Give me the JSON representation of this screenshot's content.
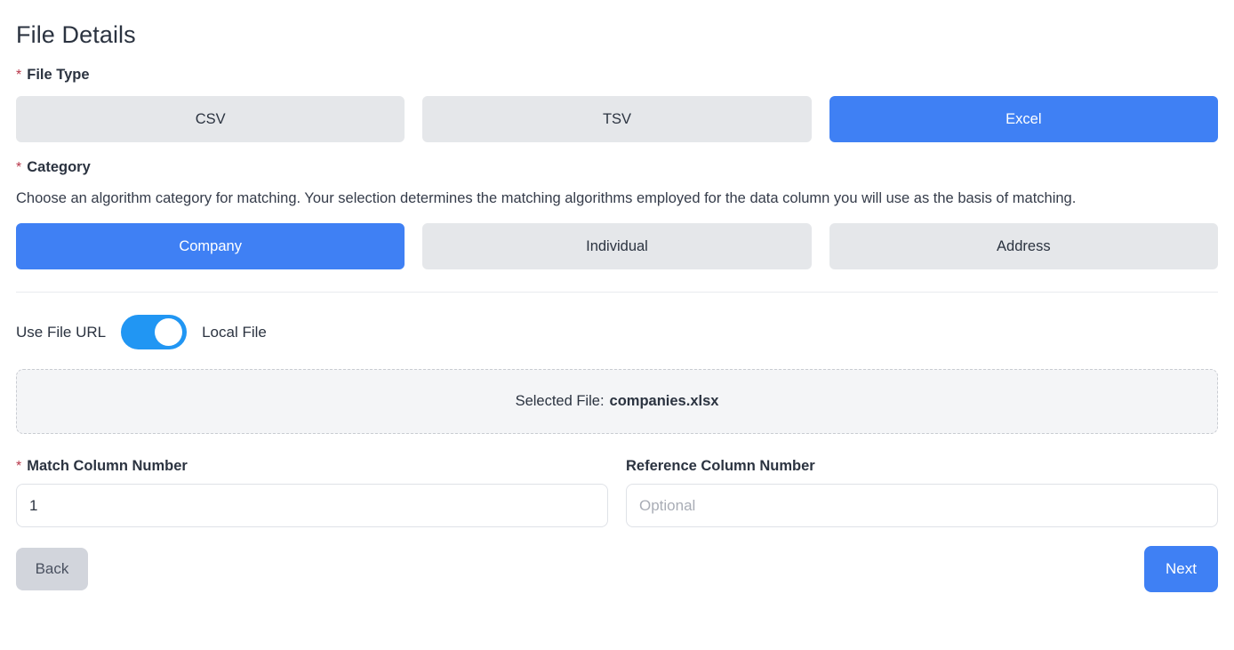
{
  "page": {
    "title": "File Details"
  },
  "file_type": {
    "label": "File Type",
    "required_marker": "*",
    "required": true,
    "selected": "Excel",
    "options": [
      {
        "label": "CSV",
        "selected": false
      },
      {
        "label": "TSV",
        "selected": false
      },
      {
        "label": "Excel",
        "selected": true
      }
    ]
  },
  "category": {
    "label": "Category",
    "required_marker": "*",
    "required": true,
    "description": "Choose an algorithm category for matching. Your selection determines the matching algorithms employed for the data column you will use as the basis of matching.",
    "selected": "Company",
    "options": [
      {
        "label": "Company",
        "selected": true
      },
      {
        "label": "Individual",
        "selected": false
      },
      {
        "label": "Address",
        "selected": false
      }
    ]
  },
  "source_toggle": {
    "left_label": "Use File URL",
    "right_label": "Local File",
    "state": "Local File",
    "on": true
  },
  "dropzone": {
    "prefix": "Selected File:",
    "filename": "companies.xlsx"
  },
  "match_column": {
    "label": "Match Column Number",
    "required_marker": "*",
    "required": true,
    "value": "1",
    "placeholder": ""
  },
  "reference_column": {
    "label": "Reference Column Number",
    "required": false,
    "value": "",
    "placeholder": "Optional"
  },
  "footer": {
    "back_label": "Back",
    "next_label": "Next"
  },
  "colors": {
    "accent_blue": "#3f80f4",
    "toggle_blue": "#2196f3",
    "unselected_gray": "#e5e7ea",
    "required_red": "#b8384b",
    "back_gray": "#d2d5dc"
  }
}
